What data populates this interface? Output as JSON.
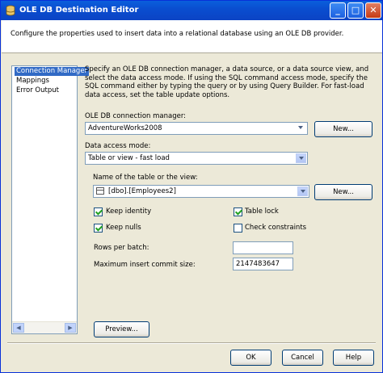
{
  "window": {
    "title": "OLE DB Destination Editor",
    "minimize_symbol": "_",
    "maximize_symbol": "□",
    "close_symbol": "✕"
  },
  "header": {
    "description": "Configure the properties used to insert data into a relational database using an OLE DB provider."
  },
  "nav": {
    "items": [
      {
        "label": "Connection Manager",
        "selected": true
      },
      {
        "label": "Mappings",
        "selected": false
      },
      {
        "label": "Error Output",
        "selected": false
      }
    ]
  },
  "main": {
    "instructions": "Specify an OLE DB connection manager, a data source, or a data source view, and select the data access mode. If using the SQL command access mode, specify the SQL command either by typing the query or by using Query Builder. For fast-load data access, set the table update options.",
    "connection_manager_label": "OLE DB connection manager:",
    "connection_manager_value": "AdventureWorks2008",
    "new_connection_label": "New...",
    "data_access_mode_label": "Data access mode:",
    "data_access_mode_value": "Table or view - fast load",
    "table_name_label": "Name of the table or the view:",
    "table_name_value": "[dbo].[Employees2]",
    "new_table_label": "New...",
    "keep_identity_label": "Keep identity",
    "keep_identity_checked": true,
    "table_lock_label": "Table lock",
    "table_lock_checked": true,
    "keep_nulls_label": "Keep nulls",
    "keep_nulls_checked": true,
    "check_constraints_label": "Check constraints",
    "check_constraints_checked": false,
    "rows_per_batch_label": "Rows per batch:",
    "rows_per_batch_value": "",
    "max_commit_label": "Maximum insert commit size:",
    "max_commit_value": "2147483647",
    "preview_label": "Preview..."
  },
  "footer": {
    "ok_label": "OK",
    "cancel_label": "Cancel",
    "help_label": "Help"
  },
  "colors": {
    "titlebar": "#0a4ed0",
    "dialog_bg": "#ece9d8",
    "selection": "#316ac5",
    "check_mark": "#21a121"
  }
}
